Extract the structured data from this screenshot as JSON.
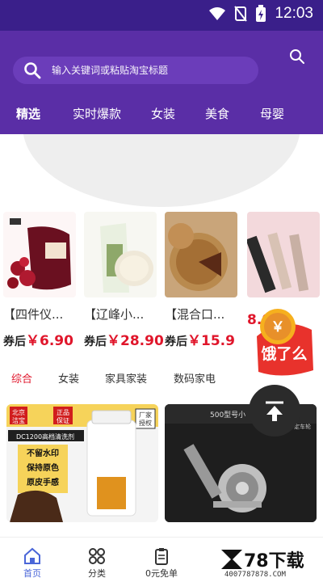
{
  "status_bar": {
    "time": "12:03"
  },
  "search": {
    "placeholder": "输入关键词或粘贴淘宝标题"
  },
  "tabs": [
    {
      "label": "精选",
      "active": true
    },
    {
      "label": "实时爆款"
    },
    {
      "label": "女装"
    },
    {
      "label": "美食"
    },
    {
      "label": "母婴"
    }
  ],
  "products": [
    {
      "title": "【四件仪...",
      "coupon_label": "券后",
      "price": "￥6.90"
    },
    {
      "title": "【辽峰小...",
      "coupon_label": "券后",
      "price": "￥28.90"
    },
    {
      "title": "【混合口...",
      "coupon_label": "券后",
      "price": "￥15.9"
    },
    {
      "title": "",
      "coupon_label": "",
      "price": "8.00"
    }
  ],
  "redpacket": {
    "text": "饿了么",
    "symbol": "￥"
  },
  "categories": [
    {
      "label": "综合",
      "active": true
    },
    {
      "label": "女装"
    },
    {
      "label": "家具家装"
    },
    {
      "label": "数码家电"
    }
  ],
  "cards": [
    {
      "badges": [
        "北京",
        "洁宝",
        "正品",
        "保证",
        "厂家",
        "授权"
      ],
      "headline": "DC1200高档清洗剂",
      "lines": [
        "不留水印",
        "保持原色",
        "原皮手感"
      ]
    },
    {
      "headline": "500型号小",
      "badge": "AD定车轮"
    }
  ],
  "bottom_nav": [
    {
      "label": "首页",
      "active": true
    },
    {
      "label": "分类"
    },
    {
      "label": "0元免单"
    }
  ],
  "watermark": {
    "title": "78下载",
    "url": "4007787878.COM"
  },
  "colors": {
    "header": "#5a2ea6",
    "status": "#3a1f8a",
    "price": "#e0162b",
    "nav_active": "#4a66d8"
  }
}
